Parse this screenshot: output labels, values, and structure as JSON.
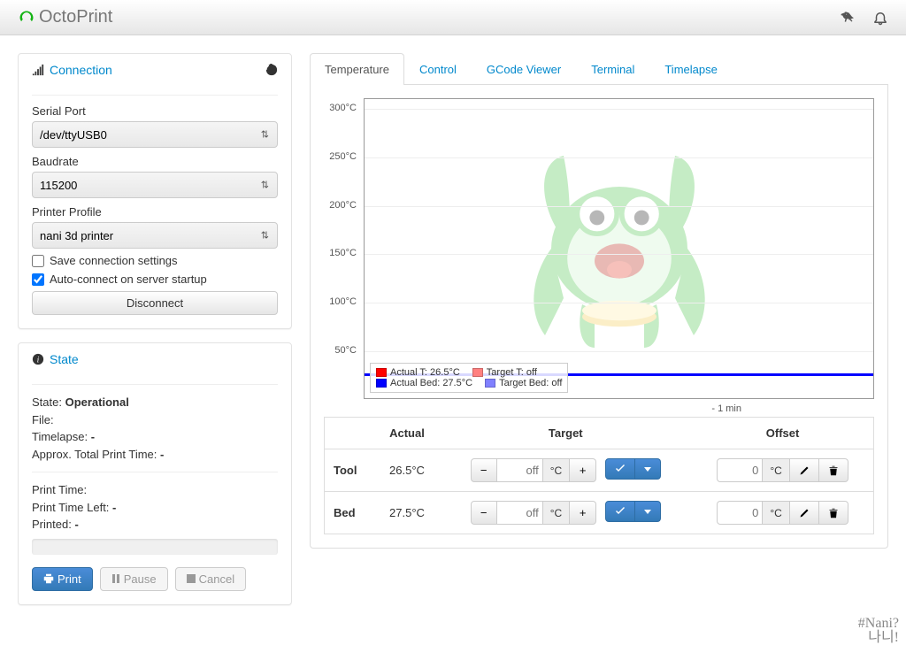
{
  "brand": "OctoPrint",
  "sidebar": {
    "connection": {
      "title": "Connection",
      "serial_label": "Serial Port",
      "serial_value": "/dev/ttyUSB0",
      "baud_label": "Baudrate",
      "baud_value": "115200",
      "profile_label": "Printer Profile",
      "profile_value": "nani 3d printer",
      "save_label": "Save connection settings",
      "auto_label": "Auto-connect on server startup",
      "disconnect_label": "Disconnect"
    },
    "state": {
      "title": "State",
      "state_label": "State:",
      "state_value": "Operational",
      "file_label": "File:",
      "file_value": "",
      "timelapse_label": "Timelapse:",
      "timelapse_value": "-",
      "approx_label": "Approx. Total Print Time:",
      "approx_value": "-",
      "printtime_label": "Print Time:",
      "printtime_value": "",
      "printleft_label": "Print Time Left:",
      "printleft_value": "-",
      "printed_label": "Printed:",
      "printed_value": "-",
      "print_btn": "Print",
      "pause_btn": "Pause",
      "cancel_btn": "Cancel"
    }
  },
  "tabs": [
    "Temperature",
    "Control",
    "GCode Viewer",
    "Terminal",
    "Timelapse"
  ],
  "chart_data": {
    "type": "line",
    "ylabel": "",
    "ylim": [
      0,
      310
    ],
    "yticks": [
      50,
      100,
      150,
      200,
      250,
      300
    ],
    "yunit": "°C",
    "x_marker": "- 1 min",
    "series": [
      {
        "name": "Actual T",
        "value": "26.5°C",
        "color": "#ff0000"
      },
      {
        "name": "Target T",
        "value": "off",
        "color": "#ff8080"
      },
      {
        "name": "Actual Bed",
        "value": "27.5°C",
        "color": "#0000ff"
      },
      {
        "name": "Target Bed",
        "value": "off",
        "color": "#8080ff"
      }
    ],
    "current": {
      "tool_actual": 26.5,
      "bed_actual": 27.5
    }
  },
  "table": {
    "headers": {
      "name": "",
      "actual": "Actual",
      "target": "Target",
      "offset": "Offset"
    },
    "rows": [
      {
        "name": "Tool",
        "actual": "26.5°C",
        "target_placeholder": "off",
        "unit": "°C",
        "offset_placeholder": "0"
      },
      {
        "name": "Bed",
        "actual": "27.5°C",
        "target_placeholder": "off",
        "unit": "°C",
        "offset_placeholder": "0"
      }
    ]
  },
  "handwriting": {
    "l1": "#Nani?",
    "l2": "나니!"
  }
}
